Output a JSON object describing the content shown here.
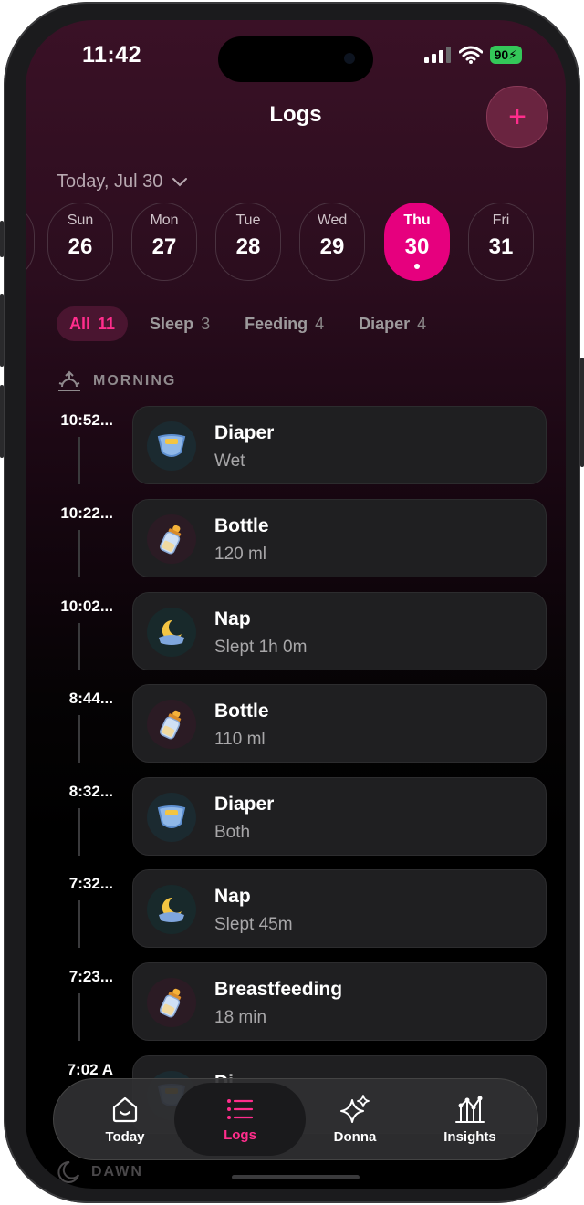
{
  "status_bar": {
    "time": "11:42",
    "battery": "90"
  },
  "header": {
    "title": "Logs",
    "add_icon": "plus-icon"
  },
  "date_selector": {
    "label": "Today, Jul 30"
  },
  "days": [
    {
      "name": "Sun",
      "num": "26",
      "active": false
    },
    {
      "name": "Mon",
      "num": "27",
      "active": false
    },
    {
      "name": "Tue",
      "num": "28",
      "active": false
    },
    {
      "name": "Wed",
      "num": "29",
      "active": false
    },
    {
      "name": "Thu",
      "num": "30",
      "active": true
    },
    {
      "name": "Fri",
      "num": "31",
      "active": false
    }
  ],
  "filters": [
    {
      "label": "All",
      "count": "11",
      "active": true
    },
    {
      "label": "Sleep",
      "count": "3",
      "active": false
    },
    {
      "label": "Feeding",
      "count": "4",
      "active": false
    },
    {
      "label": "Diaper",
      "count": "4",
      "active": false
    }
  ],
  "section_morning": {
    "label": "MORNING",
    "icon": "sunrise-icon"
  },
  "entries": [
    {
      "time": "10:52...",
      "title": "Diaper",
      "subtitle": "Wet",
      "icon": "diaper-icon"
    },
    {
      "time": "10:22...",
      "title": "Bottle",
      "subtitle": "120 ml",
      "icon": "bottle-icon"
    },
    {
      "time": "10:02...",
      "title": "Nap",
      "subtitle": "Slept 1h 0m",
      "icon": "moon-icon"
    },
    {
      "time": "8:44...",
      "title": "Bottle",
      "subtitle": "110 ml",
      "icon": "bottle-icon"
    },
    {
      "time": "8:32...",
      "title": "Diaper",
      "subtitle": "Both",
      "icon": "diaper-icon"
    },
    {
      "time": "7:32...",
      "title": "Nap",
      "subtitle": "Slept 45m",
      "icon": "moon-icon"
    },
    {
      "time": "7:23...",
      "title": "Breastfeeding",
      "subtitle": "18 min",
      "icon": "bottle-icon"
    },
    {
      "time": "7:02 A",
      "title": "Di",
      "subtitle": "",
      "icon": "diaper-icon"
    }
  ],
  "section_dawn": {
    "label": "DAWN",
    "icon": "moon-icon"
  },
  "tabs": [
    {
      "label": "Today",
      "icon": "home-icon",
      "active": false
    },
    {
      "label": "Logs",
      "icon": "list-icon",
      "active": true
    },
    {
      "label": "Donna",
      "icon": "sparkles-icon",
      "active": false
    },
    {
      "label": "Insights",
      "icon": "chart-icon",
      "active": false
    }
  ]
}
